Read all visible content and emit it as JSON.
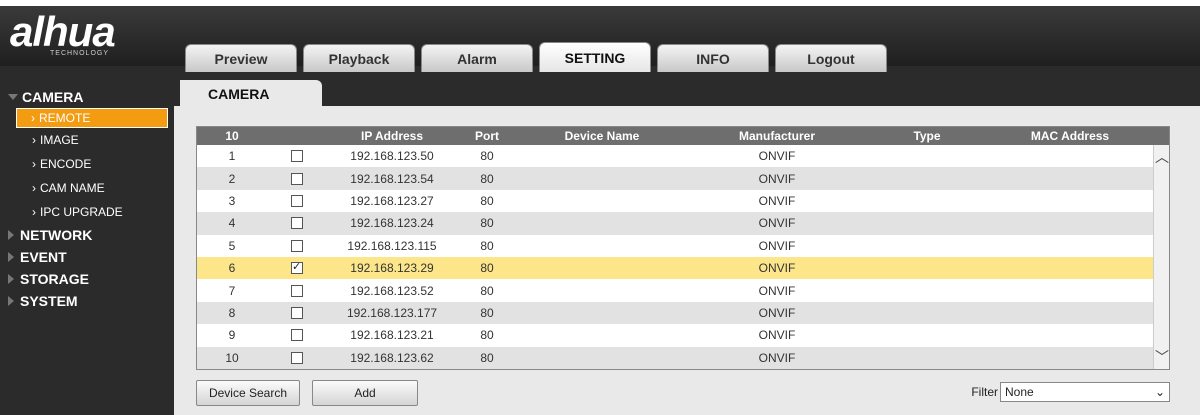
{
  "brand": {
    "name": "alhua",
    "sub": "TECHNOLOGY"
  },
  "tabs": [
    {
      "label": "Preview"
    },
    {
      "label": "Playback"
    },
    {
      "label": "Alarm"
    },
    {
      "label": "SETTING",
      "active": true
    },
    {
      "label": "INFO"
    },
    {
      "label": "Logout"
    }
  ],
  "sidebar": {
    "camera": "CAMERA",
    "camera_items": [
      "REMOTE",
      "IMAGE",
      "ENCODE",
      "CAM NAME",
      "IPC UPGRADE"
    ],
    "selected_item": "REMOTE",
    "sections": [
      "NETWORK",
      "EVENT",
      "STORAGE",
      "SYSTEM"
    ]
  },
  "content_tab": "CAMERA",
  "table": {
    "count": "10",
    "headers": {
      "ip": "IP Address",
      "port": "Port",
      "name": "Device Name",
      "manufacturer": "Manufacturer",
      "type": "Type",
      "mac": "MAC Address"
    },
    "rows": [
      {
        "num": "1",
        "checked": false,
        "ip": "192.168.123.50",
        "port": "80",
        "name": "",
        "manufacturer": "ONVIF",
        "type": "",
        "mac": ""
      },
      {
        "num": "2",
        "checked": false,
        "ip": "192.168.123.54",
        "port": "80",
        "name": "",
        "manufacturer": "ONVIF",
        "type": "",
        "mac": ""
      },
      {
        "num": "3",
        "checked": false,
        "ip": "192.168.123.27",
        "port": "80",
        "name": "",
        "manufacturer": "ONVIF",
        "type": "",
        "mac": ""
      },
      {
        "num": "4",
        "checked": false,
        "ip": "192.168.123.24",
        "port": "80",
        "name": "",
        "manufacturer": "ONVIF",
        "type": "",
        "mac": ""
      },
      {
        "num": "5",
        "checked": false,
        "ip": "192.168.123.115",
        "port": "80",
        "name": "",
        "manufacturer": "ONVIF",
        "type": "",
        "mac": ""
      },
      {
        "num": "6",
        "checked": true,
        "ip": "192.168.123.29",
        "port": "80",
        "name": "",
        "manufacturer": "ONVIF",
        "type": "",
        "mac": "",
        "selected": true
      },
      {
        "num": "7",
        "checked": false,
        "ip": "192.168.123.52",
        "port": "80",
        "name": "",
        "manufacturer": "ONVIF",
        "type": "",
        "mac": ""
      },
      {
        "num": "8",
        "checked": false,
        "ip": "192.168.123.177",
        "port": "80",
        "name": "",
        "manufacturer": "ONVIF",
        "type": "",
        "mac": ""
      },
      {
        "num": "9",
        "checked": false,
        "ip": "192.168.123.21",
        "port": "80",
        "name": "",
        "manufacturer": "ONVIF",
        "type": "",
        "mac": ""
      },
      {
        "num": "10",
        "checked": false,
        "ip": "192.168.123.62",
        "port": "80",
        "name": "",
        "manufacturer": "ONVIF",
        "type": "",
        "mac": ""
      }
    ]
  },
  "buttons": {
    "search": "Device Search",
    "add": "Add"
  },
  "filter": {
    "label": "Filter",
    "value": "None"
  },
  "icons": {
    "scroll_up": "chevron-up-icon",
    "scroll_down": "chevron-down-icon",
    "dropdown": "chevron-down-icon"
  },
  "colors": {
    "selected_menu": "#f39c12",
    "selected_row": "#fde68a",
    "header_bg": "#6e6e6e"
  }
}
